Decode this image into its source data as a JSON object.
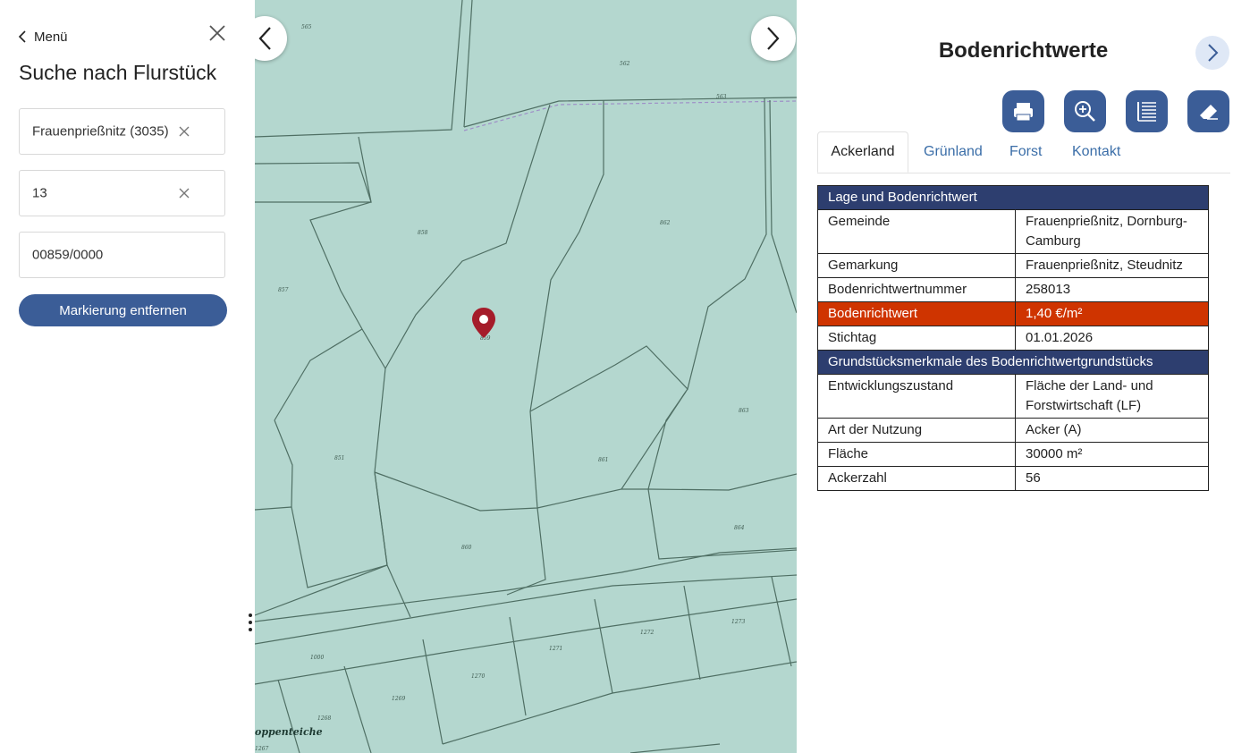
{
  "left_panel": {
    "menu_label": "Menü",
    "title": "Suche nach Flurstück",
    "fields": [
      {
        "value": "Frauenprießnitz (3035)",
        "clearable": true
      },
      {
        "value": "13",
        "clearable": true
      },
      {
        "value": "00859/0000",
        "clearable": false
      }
    ],
    "remove_button": "Markierung entfernen"
  },
  "map": {
    "parcel_labels": [
      "565",
      "562",
      "563",
      "858",
      "857",
      "862",
      "863",
      "851",
      "861",
      "860",
      "864",
      "1000",
      "1268",
      "1269",
      "1270",
      "1271",
      "1272",
      "1273",
      "1267",
      "859"
    ],
    "place_label": "oppenteiche",
    "marker_color": "#a51c2a"
  },
  "right_panel": {
    "title": "Bodenrichtwerte",
    "tools": [
      "print-icon",
      "zoom-in-icon",
      "legend-list-icon",
      "eraser-icon"
    ],
    "tabs": [
      "Ackerland",
      "Grünland",
      "Forst",
      "Kontakt"
    ],
    "active_tab": "Ackerland",
    "table": {
      "section1": "Lage und Bodenrichtwert",
      "gemeinde_k": "Gemeinde",
      "gemeinde_v": "Frauenprießnitz, Dornburg-Camburg",
      "gemarkung_k": "Gemarkung",
      "gemarkung_v": "Frauenprießnitz, Steudnitz",
      "nummer_k": "Bodenrichtwertnummer",
      "nummer_v": "258013",
      "wert_k": "Bodenrichtwert",
      "wert_v": "1,40 €/m²",
      "stichtag_k": "Stichtag",
      "stichtag_v": "01.01.2026",
      "section2": "Grundstücksmerkmale des Bodenrichtwertgrundstücks",
      "entw_k": "Entwicklungszustand",
      "entw_v": "Fläche der Land- und Forstwirtschaft (LF)",
      "nutzung_k": "Art der Nutzung",
      "nutzung_v": "Acker (A)",
      "flaeche_k": "Fläche",
      "flaeche_v": "30000 m²",
      "ackerzahl_k": "Ackerzahl",
      "ackerzahl_v": "56"
    },
    "colors": {
      "header": "#2d3e6f",
      "highlight": "#cf3400",
      "accent": "#3b5d97"
    }
  }
}
